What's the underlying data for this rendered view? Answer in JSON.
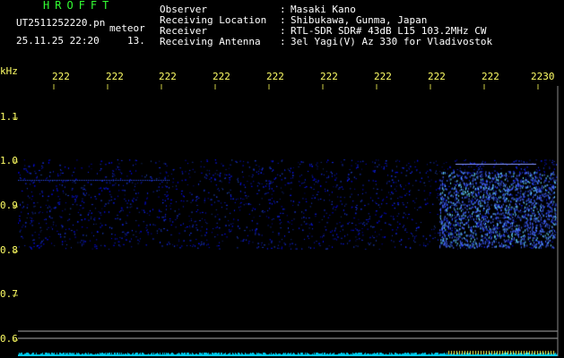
{
  "header": {
    "title": "HROFFT",
    "filename": "UT2511252220.pn",
    "meteor_label": "meteor",
    "datetime": "25.11.25 22:20",
    "meteor_count": "13."
  },
  "info": [
    {
      "label": "Observer",
      "value": "Masaki Kano"
    },
    {
      "label": "Receiving Location",
      "value": "Shibukawa, Gunma, Japan"
    },
    {
      "label": "Receiver",
      "value": "RTL-SDR SDR# 43dB L15 103.2MHz CW"
    },
    {
      "label": "Receiving Antenna",
      "value": "3el Yagi(V) Az 330 for Vladivostok"
    }
  ],
  "axis": {
    "unit_label": "kHz",
    "time_labels": [
      "222",
      "222",
      "222",
      "222",
      "222",
      "222",
      "222",
      "222",
      "222",
      "2230"
    ],
    "freq_labels": [
      "1.1",
      "1.0",
      "0.9",
      "0.8",
      "0.7",
      "0.6"
    ]
  },
  "colors": {
    "background": "#000000",
    "text": "#ffffff",
    "title": "#33ff33",
    "axis": "#ffff66",
    "signal": "#3344ff",
    "baseline": "#00ccff"
  }
}
